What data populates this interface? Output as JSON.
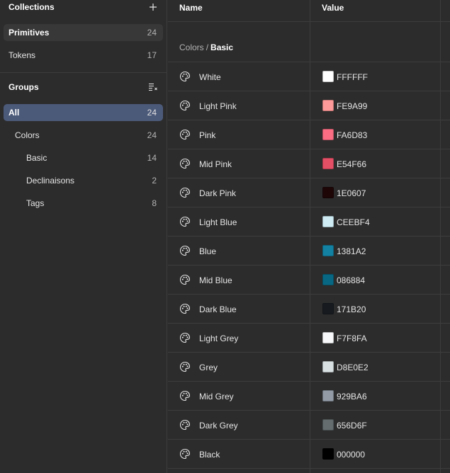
{
  "collections": {
    "title": "Collections",
    "add_icon": "plus-icon",
    "items": [
      {
        "label": "Primitives",
        "count": "24"
      },
      {
        "label": "Tokens",
        "count": "17"
      }
    ]
  },
  "groups": {
    "title": "Groups",
    "sort_icon": "sort-groups-icon",
    "items": [
      {
        "label": "All",
        "count": "24"
      },
      {
        "label": "Colors",
        "count": "24"
      },
      {
        "label": "Basic",
        "count": "14"
      },
      {
        "label": "Declinaisons",
        "count": "2"
      },
      {
        "label": "Tags",
        "count": "8"
      }
    ]
  },
  "table": {
    "col_name": "Name",
    "col_value": "Value",
    "breadcrumb": {
      "parent": "Colors",
      "separator": "/",
      "current": "Basic"
    },
    "row_icon": "palette-icon",
    "rows": [
      {
        "name": "White",
        "hex": "FFFFFF",
        "color": "#FFFFFF"
      },
      {
        "name": "Light Pink",
        "hex": "FE9A99",
        "color": "#FE9A99"
      },
      {
        "name": "Pink",
        "hex": "FA6D83",
        "color": "#FA6D83"
      },
      {
        "name": "Mid Pink",
        "hex": "E54F66",
        "color": "#E54F66"
      },
      {
        "name": "Dark Pink",
        "hex": "1E0607",
        "color": "#1E0607"
      },
      {
        "name": "Light Blue",
        "hex": "CEEBF4",
        "color": "#CEEBF4"
      },
      {
        "name": "Blue",
        "hex": "1381A2",
        "color": "#1381A2"
      },
      {
        "name": "Mid Blue",
        "hex": "086884",
        "color": "#086884"
      },
      {
        "name": "Dark Blue",
        "hex": "171B20",
        "color": "#171B20"
      },
      {
        "name": "Light Grey",
        "hex": "F7F8FA",
        "color": "#F7F8FA"
      },
      {
        "name": "Grey",
        "hex": "D8E0E2",
        "color": "#D8E0E2"
      },
      {
        "name": "Mid Grey",
        "hex": "929BA6",
        "color": "#929BA6"
      },
      {
        "name": "Dark Grey",
        "hex": "656D6F",
        "color": "#656D6F"
      },
      {
        "name": "Black",
        "hex": "000000",
        "color": "#000000"
      }
    ]
  },
  "colors": {
    "background": "#2c2c2c",
    "active_group": "#4c5a7a",
    "selected_collection": "#383838",
    "divider": "#3d3d3d"
  }
}
